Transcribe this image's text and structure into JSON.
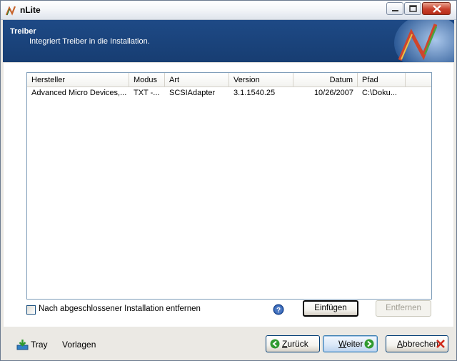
{
  "window": {
    "title": "nLite"
  },
  "header": {
    "title": "Treiber",
    "subtitle": "Integriert Treiber in die Installation."
  },
  "drivers_table": {
    "columns": [
      "Hersteller",
      "Modus",
      "Art",
      "Version",
      "Datum",
      "Pfad"
    ],
    "rows": [
      [
        "Advanced Micro Devices,...",
        "TXT -...",
        "SCSIAdapter",
        "3.1.1540.25",
        "10/26/2007",
        "C:\\Doku..."
      ]
    ]
  },
  "options": {
    "remove_after_install_label": "Nach abgeschlossener Installation entfernen",
    "remove_after_install_checked": false
  },
  "actions": {
    "insert_label": "Einfügen",
    "remove_label": "Entfernen"
  },
  "footer": {
    "tray_label": "Tray",
    "templates_label": "Vorlagen",
    "back_label": "Zurück",
    "next_label": "Weiter",
    "cancel_label": "Abbrechen"
  },
  "colors": {
    "banner": "#1e4a86",
    "accent_green": "#2f9a2f",
    "close_red": "#c8402c"
  },
  "icons": [
    "nlite-app-icon",
    "minimize-icon",
    "maximize-icon",
    "close-icon",
    "nlite-logo",
    "help-icon",
    "tray-icon",
    "back-arrow-icon",
    "next-arrow-icon",
    "cancel-x-icon"
  ]
}
